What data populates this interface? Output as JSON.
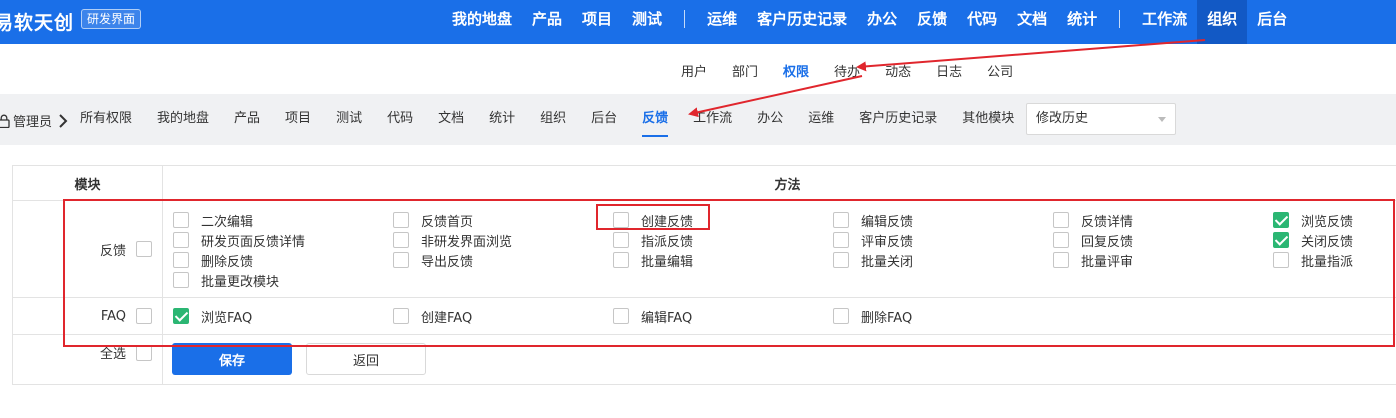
{
  "app": {
    "logo": "易软天创",
    "env_tag": "研发界面"
  },
  "top_nav": {
    "group1": [
      "我的地盘",
      "产品",
      "项目",
      "测试"
    ],
    "group2": [
      "运维",
      "客户历史记录",
      "办公",
      "反馈",
      "代码",
      "文档",
      "统计"
    ],
    "group3": [
      "工作流",
      "组织",
      "后台"
    ],
    "active": "组织"
  },
  "sub_nav": {
    "items": [
      "用户",
      "部门",
      "权限",
      "待办",
      "动态",
      "日志",
      "公司"
    ],
    "active": "权限"
  },
  "module_bar": {
    "breadcrumb": "管理员",
    "tabs": [
      "所有权限",
      "我的地盘",
      "产品",
      "项目",
      "测试",
      "代码",
      "文档",
      "统计",
      "组织",
      "后台",
      "反馈",
      "工作流",
      "办公",
      "运维",
      "客户历史记录",
      "其他模块"
    ],
    "active": "反馈",
    "history_select": "修改历史"
  },
  "table": {
    "col_module": "模块",
    "col_method": "方法",
    "rows": [
      {
        "label": "反馈",
        "checked": false,
        "methods": [
          {
            "label": "二次编辑",
            "checked": false
          },
          {
            "label": "反馈首页",
            "checked": false
          },
          {
            "label": "创建反馈",
            "checked": false
          },
          {
            "label": "编辑反馈",
            "checked": false
          },
          {
            "label": "反馈详情",
            "checked": false
          },
          {
            "label": "浏览反馈",
            "checked": true
          },
          {
            "label": "研发页面反馈详情",
            "checked": false
          },
          {
            "label": "非研发界面浏览",
            "checked": false
          },
          {
            "label": "指派反馈",
            "checked": false
          },
          {
            "label": "评审反馈",
            "checked": false
          },
          {
            "label": "回复反馈",
            "checked": false
          },
          {
            "label": "关闭反馈",
            "checked": true
          },
          {
            "label": "删除反馈",
            "checked": false
          },
          {
            "label": "导出反馈",
            "checked": false
          },
          {
            "label": "批量编辑",
            "checked": false
          },
          {
            "label": "批量关闭",
            "checked": false
          },
          {
            "label": "批量评审",
            "checked": false
          },
          {
            "label": "批量指派",
            "checked": false
          },
          {
            "label": "批量更改模块",
            "checked": false
          }
        ]
      },
      {
        "label": "FAQ",
        "checked": false,
        "methods": [
          {
            "label": "浏览FAQ",
            "checked": true
          },
          {
            "label": "创建FAQ",
            "checked": false
          },
          {
            "label": "编辑FAQ",
            "checked": false
          },
          {
            "label": "删除FAQ",
            "checked": false
          }
        ]
      }
    ],
    "select_all": {
      "label": "全选",
      "checked": false
    }
  },
  "buttons": {
    "save": "保存",
    "back": "返回"
  },
  "colors": {
    "primary": "#1a6fe8",
    "active_top": "#1259c5",
    "check": "#2bb673",
    "annotation": "#e0262d"
  }
}
